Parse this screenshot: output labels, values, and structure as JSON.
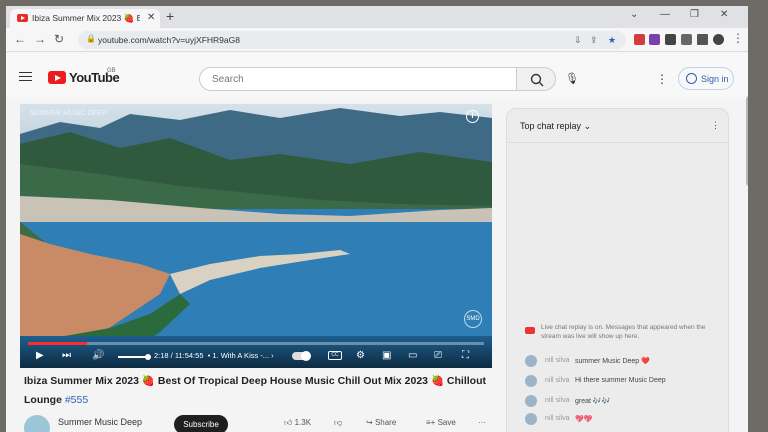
{
  "browser": {
    "tab_title": "Ibiza Summer Mix 2023 🍓 Best O",
    "tab_close": "✕",
    "new_tab": "+",
    "url": "youtube.com/watch?v=uyjXFHR9aG8",
    "window_controls": [
      "⌄",
      "—",
      "❐",
      "✕"
    ]
  },
  "youtube": {
    "logo_text": "YouTube",
    "region": "GB",
    "search_placeholder": "Search",
    "sign_in": "Sign in"
  },
  "video": {
    "channel_watermark": "SUMMER MUSIC DEEP",
    "progress": 0.13,
    "time": "2:18 / 11:54:55",
    "chapter": "• 1. With A Kiss -...",
    "cc_label": "CC",
    "watermark_badge": "SMD",
    "title": "Ibiza Summer Mix 2023 🍓 Best Of Tropical Deep House Music Chill Out Mix 2023 🍓 Chillout Lounge",
    "hashtag": "#555",
    "channel": "Summer Music Deep",
    "subscribe": "Subscribe",
    "likes": "1.3K",
    "share": "Share",
    "save": "Save"
  },
  "chat": {
    "header": "Top chat replay",
    "notice": "Live chat replay is on. Messages that appeared when the stream was live will show up here.",
    "messages": [
      {
        "author": "nill silva",
        "text": "summer Music Deep ❤️"
      },
      {
        "author": "nill silva",
        "text": "Hi there summer Music Deep"
      },
      {
        "author": "nill silva",
        "text": "great 🎶🎶"
      },
      {
        "author": "nill silva",
        "text": "💖💖"
      }
    ]
  },
  "colors": {
    "youtube_red": "#ee1d1d",
    "progress_red": "#ff2a2a",
    "link_blue": "#3361b6"
  }
}
